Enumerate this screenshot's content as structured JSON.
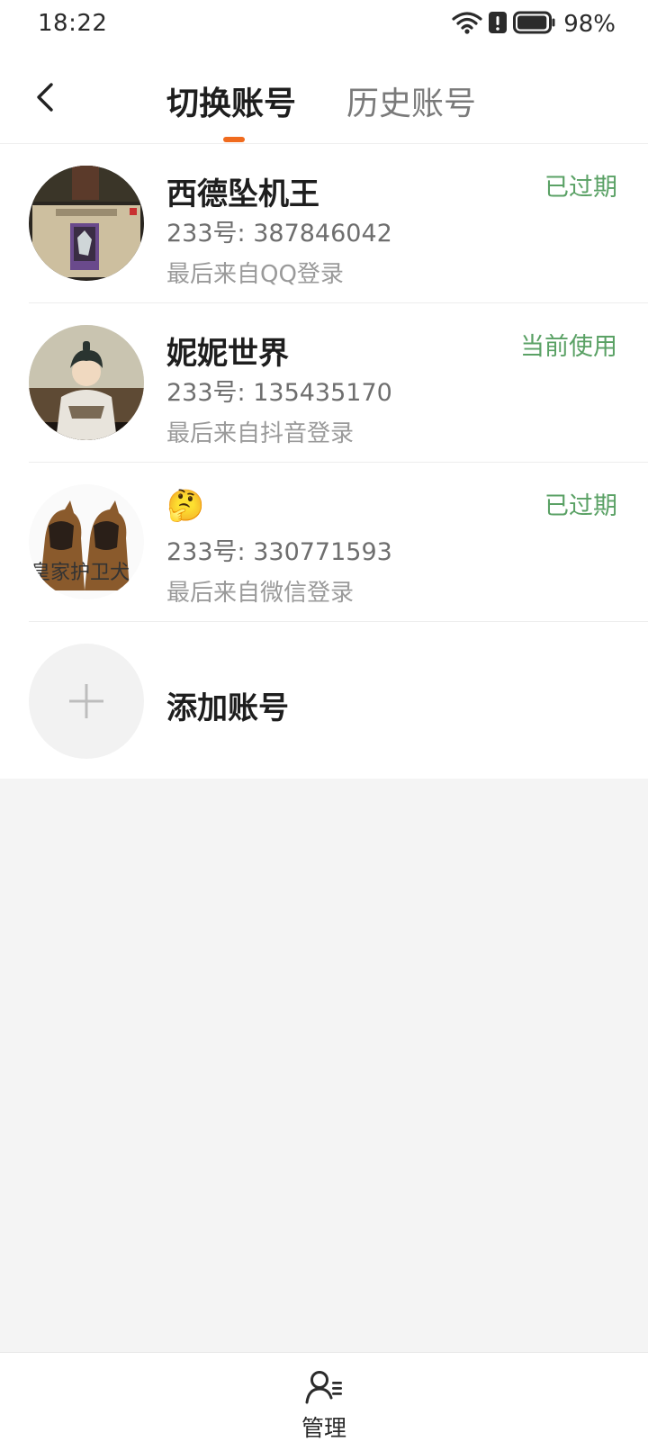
{
  "status_bar": {
    "time": "18:22",
    "battery_percent": "98%",
    "battery_level": 0.98
  },
  "header": {
    "tabs": [
      {
        "label": "切换账号",
        "active": true
      },
      {
        "label": "历史账号",
        "active": false
      }
    ],
    "accent_color": "#f06b1e"
  },
  "accounts": [
    {
      "name": "西德坠机王",
      "uid": "233号: 387846042",
      "source": "最后来自QQ登录",
      "status": "已过期",
      "avatar": "game-card-avatar"
    },
    {
      "name": "妮妮世界",
      "uid": "233号: 135435170",
      "source": "最后来自抖音登录",
      "status": "当前使用",
      "avatar": "anime-character-avatar"
    },
    {
      "name": "🤔",
      "uid": "233号: 330771593",
      "source": "最后来自微信登录",
      "status": "已过期",
      "avatar": "dogs-avatar",
      "avatar_text": "皇家护卫犬"
    }
  ],
  "add_account": {
    "label": "添加账号",
    "icon": "plus-icon"
  },
  "bottom_bar": {
    "manage_label": "管理",
    "icon": "user-manage-icon"
  },
  "colors": {
    "status_green": "#5aa165",
    "page_background": "#f4f4f4"
  }
}
